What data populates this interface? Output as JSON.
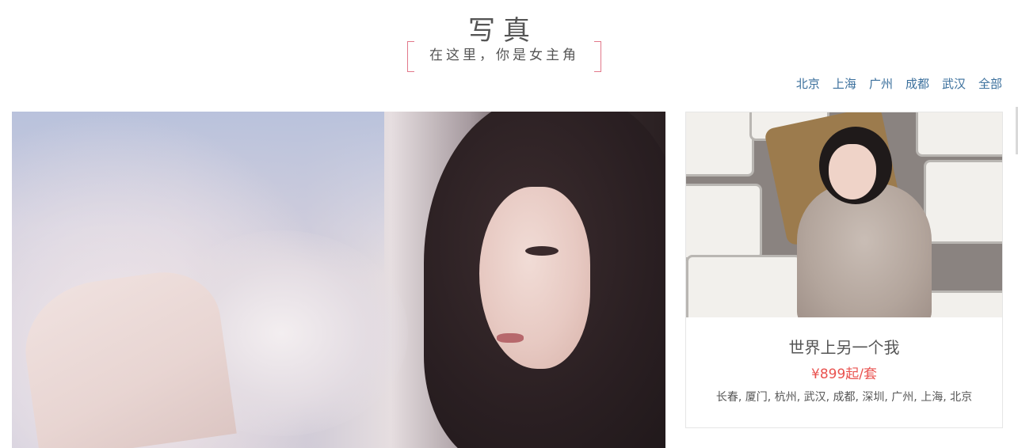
{
  "header": {
    "title": "写真",
    "subtitle": "在这里，你是女主角"
  },
  "city_nav": {
    "items": [
      {
        "label": "北京"
      },
      {
        "label": "上海"
      },
      {
        "label": "广州"
      },
      {
        "label": "成都"
      },
      {
        "label": "武汉"
      },
      {
        "label": "全部"
      }
    ]
  },
  "colors": {
    "accent_red": "#e9524f",
    "link_blue": "#3a6f9c",
    "corner_pink": "#e2788a",
    "text_gray": "#555555"
  },
  "featured_card": {
    "title": "世界上另一个我",
    "price": "¥899起/套",
    "cities": "长春, 厦门, 杭州, 武汉, 成都, 深圳, 广州, 上海, 北京"
  }
}
